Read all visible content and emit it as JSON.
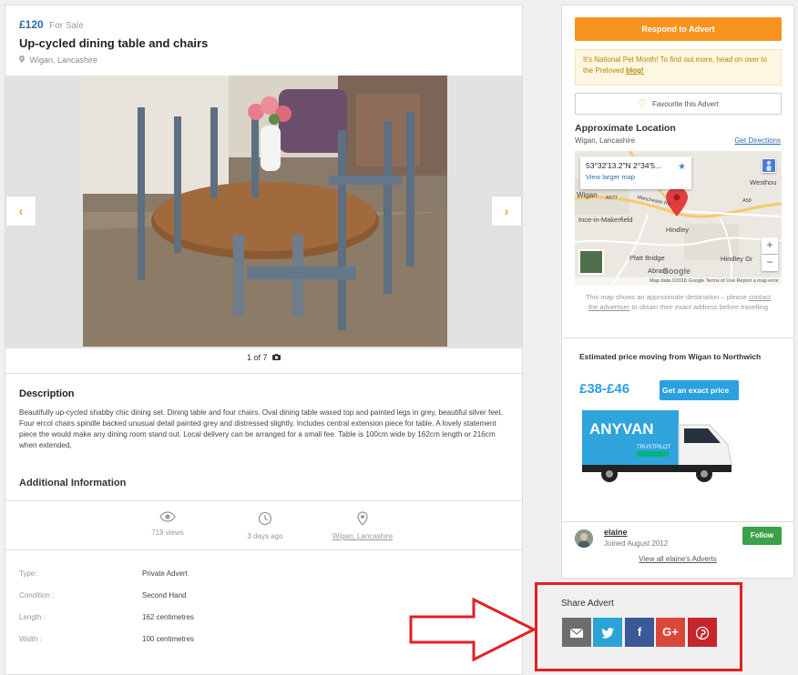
{
  "listing": {
    "price": "£120",
    "for_sale": "For Sale",
    "title": "Up-cycled dining table and chairs",
    "location": "Wigan, Lancashire"
  },
  "gallery": {
    "counter": "1 of 7",
    "prev": "‹",
    "next": "›"
  },
  "description": {
    "heading": "Description",
    "text": "Beautifully up-cycled shabby chic dining set. Dining table and four chairs. Oval dining table waxed top and painted legs in grey, beautiful silver feet. Four ercol chairs spindle backed unusual detail painted grey and distressed slightly. Includes central extension piece for table. A lovely statement piece the would make any dining room stand out. Local delivery can be arranged for a small fee. Table is 100cm wide by 162cm length or 216cm when extended,"
  },
  "additional": {
    "heading": "Additional Information",
    "stats": {
      "views": "719 views",
      "age": "3 days ago",
      "location": "Wigan, Lancashire"
    },
    "specs": [
      {
        "key": "Type:",
        "value": "Private Advert"
      },
      {
        "key": "Condition :",
        "value": "Second Hand"
      },
      {
        "key": "Length :",
        "value": "162 centimetres"
      },
      {
        "key": "Width :",
        "value": "100 centimetres"
      }
    ]
  },
  "sidebar": {
    "respond_label": "Respond to Advert",
    "notice_text": "It's National Pet Month! To find out more, head on over to the Preloved ",
    "notice_link": "blog!",
    "favourite_label": "Favourite this Advert",
    "approx_heading": "Approximate Location",
    "approx_town": "Wigan, Lancashire",
    "directions_label": "Get Directions",
    "map": {
      "coords": "53°32'13.2\"N 2°34'5...",
      "larger": "View larger map",
      "labels": {
        "wigan": "Wigan",
        "westhoughton": "Westhou",
        "ince": "Ince-in-Makerfield",
        "hindley": "Hindley",
        "platt": "Platt Bridge",
        "abram": "Abram",
        "hindley_green": "Hindley Gr",
        "a577": "A577",
        "a58": "A58",
        "manchester_rd": "Manchester Rd"
      },
      "zoom_in": "+",
      "zoom_out": "−",
      "google": "Google",
      "footer": "Map data ©2018 Google   Terms of Use   Report a map error"
    },
    "map_note_a": "This map shows an approximate destination – please ",
    "map_note_link": "contact the advertiser",
    "map_note_b": " to obtain their exact address before travelling",
    "estimate_heading": "Estimated price moving from Wigan to Northwich",
    "estimate_price": "£38-£46",
    "exact_label": "Get an exact price",
    "van_brand": "ANYVAN",
    "van_trust": "TRUSTPILOT",
    "user": {
      "name": "elaine",
      "joined": "Joined August 2012",
      "follow": "Follow",
      "view_all": "View all elaine's Adverts"
    }
  },
  "share": {
    "heading": "Share Advert",
    "gplus": "G+",
    "fb": "f"
  },
  "colors": {
    "accent": "#f7931e",
    "link": "#2b6ca8",
    "highlight": "#e12024"
  }
}
